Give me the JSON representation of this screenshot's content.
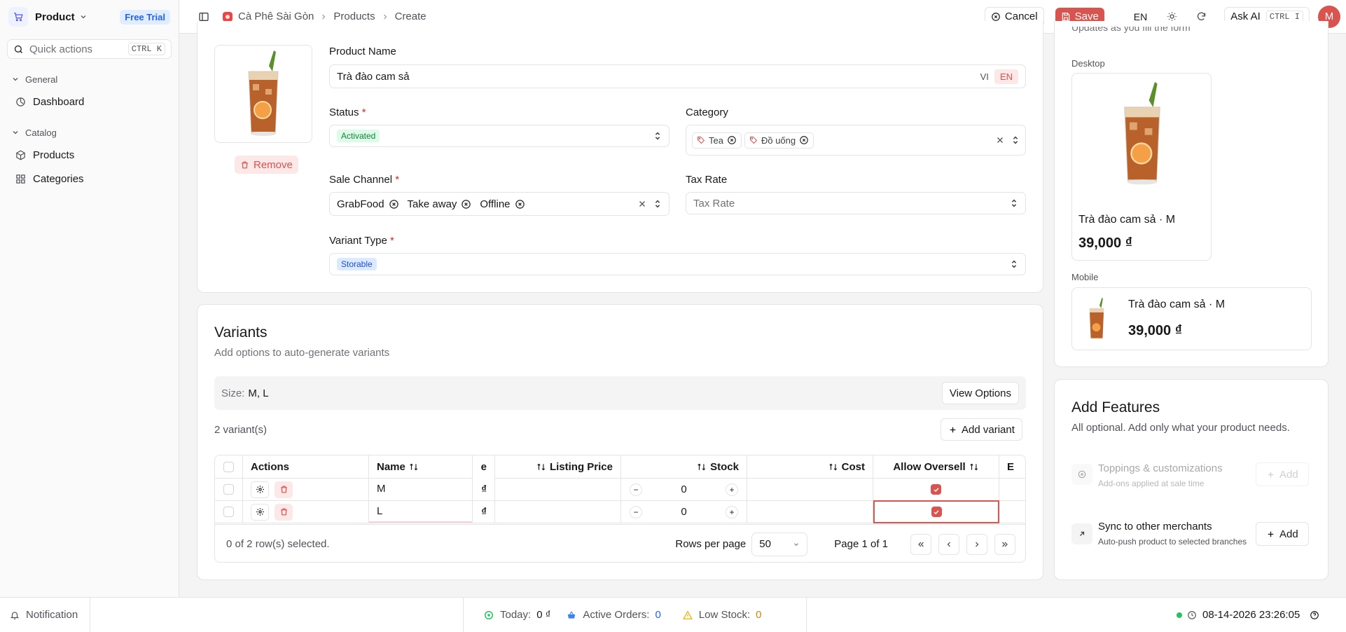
{
  "app": {
    "name": "Product",
    "trial_badge": "Free Trial"
  },
  "sidebar": {
    "quick_actions": {
      "label": "Quick actions",
      "shortcut": "CTRL K"
    },
    "groups": [
      {
        "label": "General",
        "items": [
          {
            "label": "Dashboard",
            "icon": "dashboard-icon"
          }
        ]
      },
      {
        "label": "Catalog",
        "items": [
          {
            "label": "Products",
            "icon": "box-icon"
          },
          {
            "label": "Categories",
            "icon": "grid-icon"
          }
        ]
      }
    ]
  },
  "topbar": {
    "breadcrumb": [
      "Cà Phê Sài Gòn",
      "Products",
      "Create"
    ],
    "cancel_label": "Cancel",
    "save_label": "Save",
    "language": "EN",
    "ask_ai_label": "Ask AI",
    "ask_ai_shortcut": "CTRL I",
    "avatar_initial": "M"
  },
  "form": {
    "remove_label": "Remove",
    "product_name": {
      "label": "Product Name",
      "value": "Trà đào cam sả",
      "lang_vi": "VI",
      "lang_en": "EN"
    },
    "status": {
      "label": "Status",
      "value": "Activated"
    },
    "category": {
      "label": "Category",
      "chips": [
        "Tea",
        "Đồ uống"
      ]
    },
    "sale_channel": {
      "label": "Sale Channel",
      "chips": [
        "GrabFood",
        "Take away",
        "Offline"
      ]
    },
    "tax_rate": {
      "label": "Tax Rate",
      "placeholder": "Tax Rate"
    },
    "variant_type": {
      "label": "Variant Type",
      "value": "Storable"
    }
  },
  "variants": {
    "title": "Variants",
    "subtitle": "Add options to auto-generate variants",
    "size_label": "Size:",
    "size_values": "M, L",
    "view_options_label": "View Options",
    "count_label": "2 variant(s)",
    "add_variant_label": "Add variant",
    "columns": [
      "Actions",
      "Name",
      "e",
      "Listing Price",
      "Stock",
      "Cost",
      "Allow Oversell",
      "E"
    ],
    "rows": [
      {
        "name": "M",
        "price_cut": "₫",
        "stock": "0",
        "allow_oversell": true
      },
      {
        "name": "L",
        "price_cut": "₫",
        "stock": "0",
        "allow_oversell": true
      }
    ],
    "selected_label": "0 of 2 row(s) selected.",
    "rows_per_page_label": "Rows per page",
    "rows_per_page_value": "50",
    "page_label": "Page 1 of 1"
  },
  "preview": {
    "subtitle": "Updates as you fill the form",
    "desktop_label": "Desktop",
    "mobile_label": "Mobile",
    "item_name": "Trà đào cam sả · M",
    "item_price": "39,000 ₫"
  },
  "features": {
    "title": "Add Features",
    "subtitle": "All optional. Add only what your product needs.",
    "items": [
      {
        "title": "Toppings & customizations",
        "desc": "Add-ons applied at sale time",
        "button": "Add",
        "disabled": true
      },
      {
        "title": "Sync to other merchants",
        "desc": "Auto-push product to selected branches",
        "button": "Add",
        "disabled": false
      }
    ]
  },
  "statusbar": {
    "notification_label": "Notification",
    "today_label": "Today:",
    "today_value": "0 ₫",
    "orders_label": "Active Orders:",
    "orders_value": "0",
    "low_stock_label": "Low Stock:",
    "low_stock_value": "0",
    "datetime": "08-14-2026 23:26:05"
  },
  "colors": {
    "accent": "#d9534f",
    "success": "#22c55e",
    "info": "#2563eb",
    "warning": "#eab308"
  }
}
